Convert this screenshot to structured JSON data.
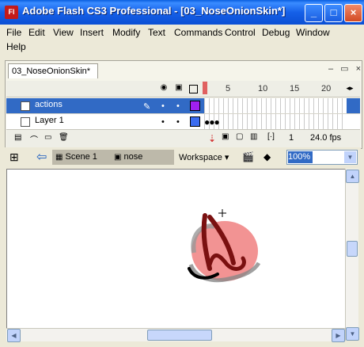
{
  "window": {
    "app_icon": "Fl",
    "title": "Adobe Flash CS3 Professional - [03_NoseOnionSkin*]",
    "minimize": "_",
    "maximize": "□",
    "close": "×"
  },
  "menu": [
    "File",
    "Edit",
    "View",
    "Insert",
    "Modify",
    "Text",
    "Commands",
    "Control",
    "Debug",
    "Window",
    "Help"
  ],
  "document": {
    "tab_label": "03_NoseOnionSkin*"
  },
  "timeline": {
    "frame_numbers": [
      "5",
      "10",
      "15",
      "20"
    ],
    "layers": [
      {
        "name": "actions",
        "selected": true,
        "outline_color": "#a020f0"
      },
      {
        "name": "Layer 1",
        "selected": false,
        "outline_color": "#3b6cf0"
      }
    ],
    "current_frame": "1",
    "fps": "24.0 fps"
  },
  "editbar": {
    "scene": "Scene 1",
    "symbol": "nose",
    "workspace": "Workspace",
    "zoom": "100%"
  },
  "colors": {
    "titlebar": "#0b4fd4",
    "selection": "#316ac5",
    "onion_fill": "#f08080"
  }
}
